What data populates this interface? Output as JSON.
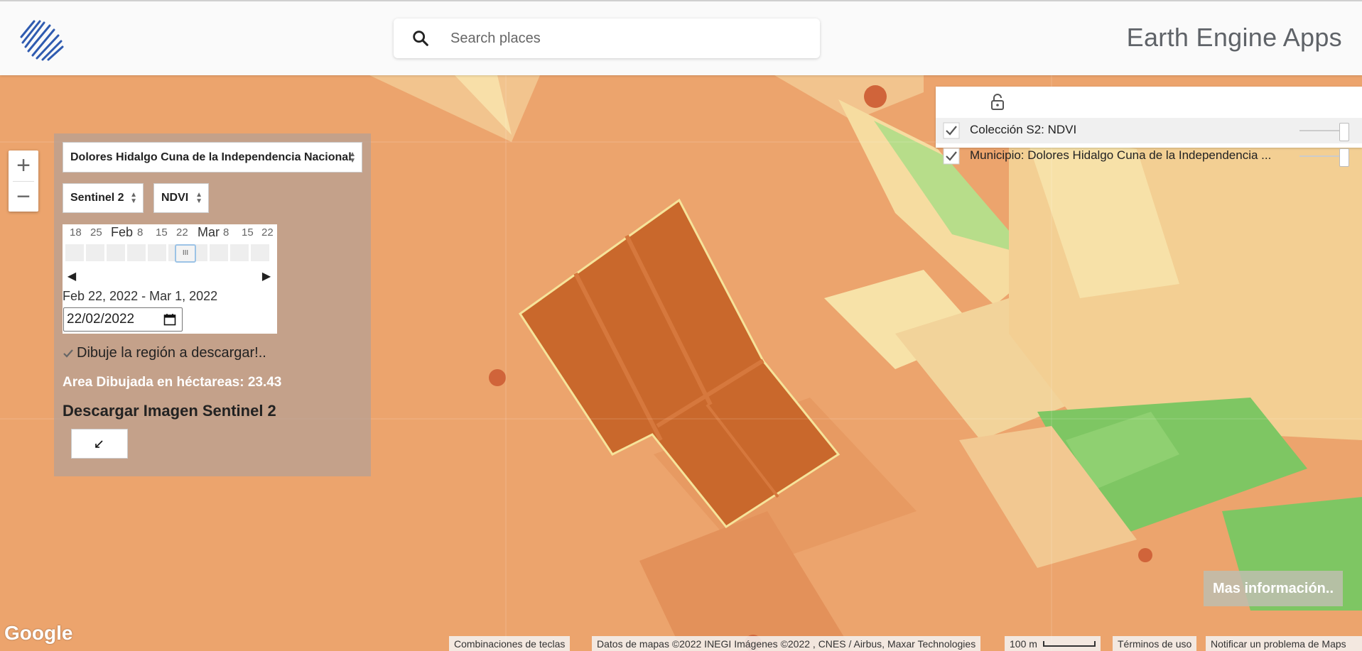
{
  "header": {
    "search_placeholder": "Search places",
    "app_title": "Earth Engine Apps",
    "logo_icon": "earth-engine-logo-icon",
    "search_icon": "search-icon"
  },
  "zoom": {
    "in_label": "+",
    "out_label": "−"
  },
  "panel": {
    "region_select": "Dolores Hidalgo Cuna de la Independencia Nacional",
    "satellite_select": "Sentinel 2",
    "index_select": "NDVI",
    "timeline_ticks": [
      "18",
      "25",
      "Feb",
      "8",
      "15",
      "22",
      "Mar",
      "8",
      "15",
      "22"
    ],
    "prev_arrow": "◀",
    "next_arrow": "▶",
    "handle_label": "III",
    "date_range": "Feb 22, 2022 - Mar 1, 2022",
    "date_value": "22/02/2022",
    "draw_checkbox_label": "Dibuje la región a descargar!..",
    "draw_checked": true,
    "area_text": "Area Dibujada en héctareas: 23.43",
    "download_title": "Descargar Imagen Sentinel 2",
    "download_button_icon": "pencil-download-icon"
  },
  "layers": {
    "lock_icon": "lock-open-icon",
    "items": [
      {
        "label": "Colección S2: NDVI",
        "checked": true,
        "opacity": 1.0
      },
      {
        "label": "Municipio: Dolores Hidalgo Cuna de la Independencia ...",
        "checked": true,
        "opacity": 1.0
      }
    ]
  },
  "more_info": "Mas información..",
  "footer": {
    "google": "Google",
    "shortcuts": "Combinaciones de teclas",
    "map_data": "Datos de mapas ©2022 INEGI Imágenes ©2022 , CNES / Airbus, Maxar Technologies",
    "scale": "100 m",
    "terms": "Términos de uso",
    "report": "Notificar un problema de Maps"
  },
  "colors": {
    "ndvi_low": "#e7965f",
    "ndvi_mid": "#f6dca0",
    "ndvi_high": "#6fc25a",
    "drawn_region": "#c9682c"
  }
}
